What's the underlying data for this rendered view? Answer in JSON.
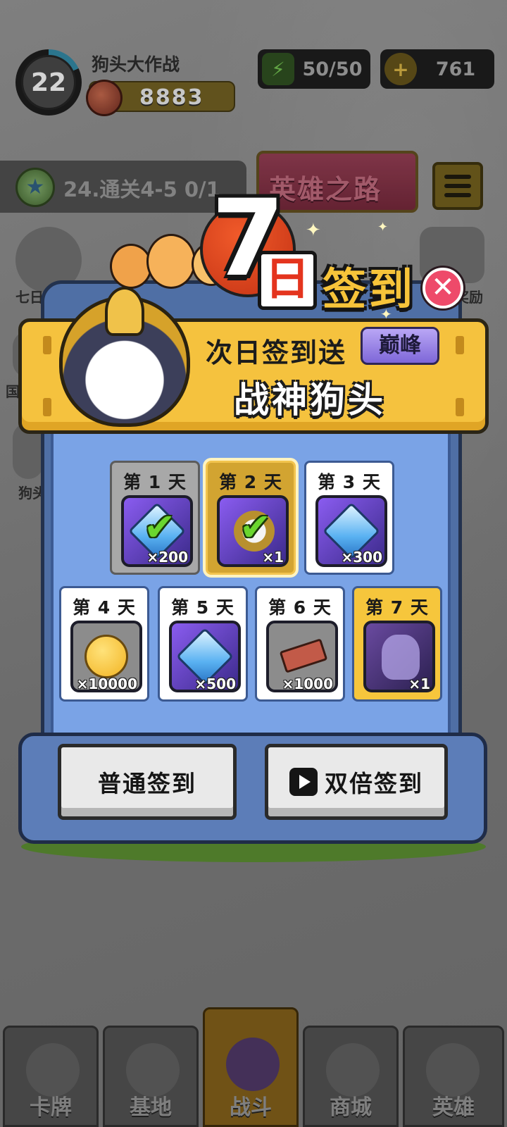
{
  "hud": {
    "level": "22",
    "player_name": "狗头大作战",
    "power": "8883",
    "energy": "50/50",
    "coins": "761"
  },
  "quest": {
    "text": "24.通关4-5  0/1",
    "hero_road_label": "英雄之路"
  },
  "side_labels": {
    "left_top": "七日",
    "left_mid": "国",
    "left_low": "狗头",
    "right_top": "奖励"
  },
  "popup": {
    "title_number": "7",
    "title_ri": "日",
    "title_rest": "签到",
    "banner_line1": "次日签到送",
    "peak_badge": "巅峰",
    "banner_line2": "战神狗头",
    "days": [
      {
        "label": "第 1 天",
        "qty": "×200",
        "reward": "diamond",
        "state": "claimed"
      },
      {
        "label": "第 2 天",
        "qty": "×1",
        "reward": "hero-shard",
        "state": "today"
      },
      {
        "label": "第 3 天",
        "qty": "×300",
        "reward": "diamond",
        "state": "pending"
      },
      {
        "label": "第 4 天",
        "qty": "×10000",
        "reward": "gold-coin",
        "state": "pending"
      },
      {
        "label": "第 5 天",
        "qty": "×500",
        "reward": "diamond",
        "state": "pending"
      },
      {
        "label": "第 6 天",
        "qty": "×1000",
        "reward": "brick",
        "state": "pending"
      },
      {
        "label": "第 7 天",
        "qty": "×1",
        "reward": "mystery-hero",
        "state": "final"
      }
    ],
    "normal_button": "普通签到",
    "double_button": "双倍签到"
  },
  "nav": [
    {
      "label": "卡牌"
    },
    {
      "label": "基地"
    },
    {
      "label": "战斗"
    },
    {
      "label": "商城"
    },
    {
      "label": "英雄"
    }
  ],
  "colors": {
    "banner": "#f5c23e",
    "panel": "#4f6fa5",
    "close": "#ee4a6a",
    "accent_orange": "#e4341e"
  }
}
